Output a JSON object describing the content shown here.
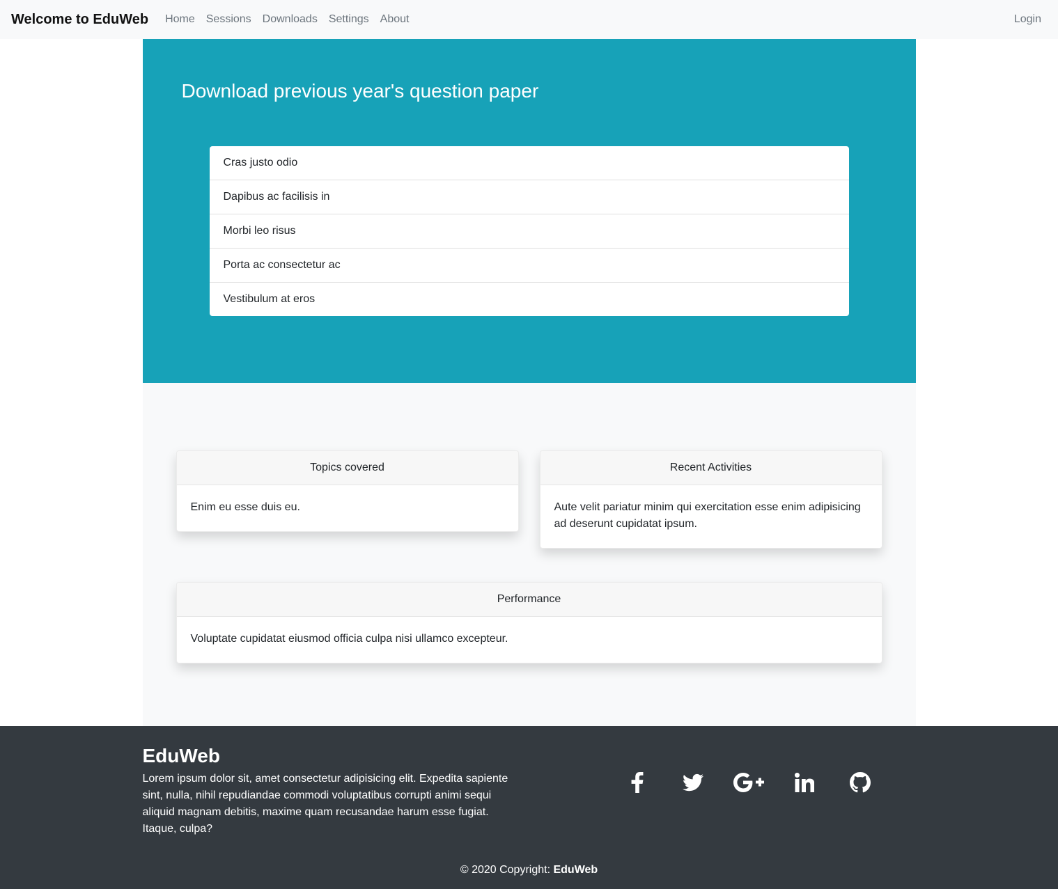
{
  "navbar": {
    "brand": "Welcome to EduWeb",
    "links": [
      "Home",
      "Sessions",
      "Downloads",
      "Settings",
      "About"
    ],
    "login": "Login"
  },
  "hero": {
    "title": "Download previous year's question paper",
    "background_color": "#17a2b8",
    "items": [
      "Cras justo odio",
      "Dapibus ac facilisis in",
      "Morbi leo risus",
      "Porta ac consectetur ac",
      "Vestibulum at eros"
    ]
  },
  "cards": {
    "topics": {
      "header": "Topics covered",
      "body": "Enim eu esse duis eu."
    },
    "recent": {
      "header": "Recent Activities",
      "body": "Aute velit pariatur minim qui exercitation esse enim adipisicing ad deserunt cupidatat ipsum."
    },
    "performance": {
      "header": "Performance",
      "body": "Voluptate cupidatat eiusmod officia culpa nisi ullamco excepteur."
    }
  },
  "footer": {
    "title": "EduWeb",
    "text": "Lorem ipsum dolor sit, amet consectetur adipisicing elit. Expedita sapiente sint, nulla, nihil repudiandae commodi voluptatibus corrupti animi sequi aliquid magnam debitis, maxime quam recusandae harum esse fugiat. Itaque, culpa?",
    "social": [
      "facebook-icon",
      "twitter-icon",
      "google-plus-icon",
      "linkedin-icon",
      "github-icon"
    ],
    "copyright_prefix": "© 2020 Copyright: ",
    "copyright_brand": "EduWeb"
  }
}
